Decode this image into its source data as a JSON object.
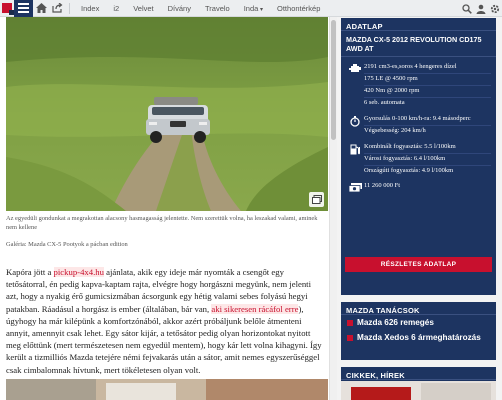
{
  "nav": {
    "links": [
      "Index",
      "i2",
      "Velvet",
      "Dívány",
      "Travelo",
      "Inda",
      "Otthontérkép"
    ]
  },
  "article": {
    "caption": "Az egyedüli gondunkat a megrakottan alacsony hasmagasság jelentette. Nem szerettük volna, ha leszakad valami, aminek nem kellene",
    "credit": "Galéria: Mazda CX-5 Pootyok a pácban edition",
    "body_parts": [
      {
        "t": "Kapóra jött a ",
        "hl": false
      },
      {
        "t": "pickup-4x4.hu",
        "hl": true
      },
      {
        "t": " ajánlata, akik egy ideje már nyomták a csengőt egy tetősátorral, én pedig kapva-kaptam rajta, elvégre hogy horgászni megyünk, nem jelenti azt, hogy a nyakig érő gumicsizmában ácsorgunk egy hétig valami sebes folyású hegyi patakban. Ráadásul a horgász is ember (általában, bár van, ",
        "hl": false
      },
      {
        "t": "aki sikeresen rácáfol erre",
        "hl": true
      },
      {
        "t": "), úgyhogy ha már kilépünk a komfortzónából, akkor azért próbáljunk belőle átmenteni annyit, amennyit csak lehet. Egy sátor kijár, a tetősátor pedig olyan horizontokat nyitott meg előttünk (mert természetesen nem egyedül mentem), hogy kár lett volna kihagyni. Így került a tizmilliós Mazda tetejére némi fejvakarás után a sátor, amit nemes egyszerűséggel csak cimbalomnak hívtunk, mert tökéletesen olyan volt.",
        "hl": false
      }
    ]
  },
  "sidebar": {
    "spec_header": "ADATLAP",
    "car_title": "MAZDA CX-5 2012 REVOLUTION CD175 AWD AT",
    "engine": [
      "2191 cm3-es,soros 4 hengeres dízel",
      "175 LE @ 4500 rpm",
      "420 Nm @ 2000 rpm",
      "6 seb. automata"
    ],
    "performance": [
      "Gyorsulás 0-100 km/h-ra: 9.4 másodperc",
      "Végsebesség: 204 km/h"
    ],
    "consumption": [
      "Kombinált fogyasztás: 5.5 l/100km",
      "Városi fogyasztás: 6.4 l/100km",
      "Országúti fogyasztás: 4.9 l/100km"
    ],
    "price": "11 260 000 Ft",
    "details_button": "RÉSZLETES ADATLAP",
    "tips_header": "MAZDA TANÁCSOK",
    "tips": [
      "Mazda 626 remegés",
      "Mazda Xedos 6 ármeghatározás"
    ],
    "news_header": "CIKKEK, HÍREK"
  },
  "colors": {
    "navy": "#1d3461",
    "red": "#c8102e"
  },
  "icons": [
    "home-icon",
    "share-icon",
    "search-icon",
    "user-icon",
    "settings-icon",
    "engine-icon",
    "stopwatch-icon",
    "fuel-pump-icon",
    "money-icon",
    "gallery-icon"
  ]
}
